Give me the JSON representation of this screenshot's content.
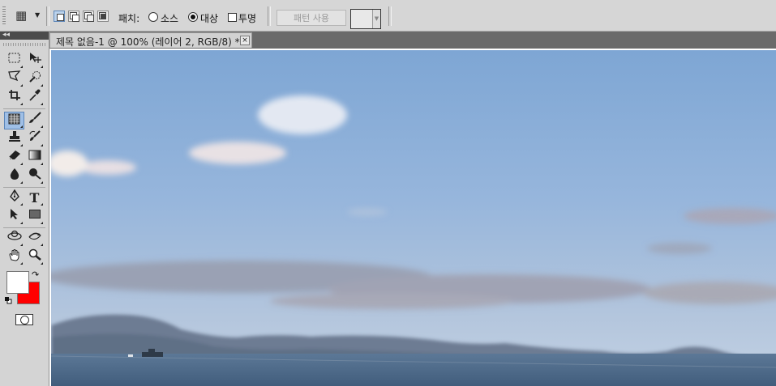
{
  "options_bar": {
    "tool_preset": {
      "icon": "patch-tool-icon"
    },
    "selection_modes": [
      "new-selection-icon",
      "add-to-selection-icon",
      "subtract-from-selection-icon",
      "intersect-selection-icon"
    ],
    "patch_label": "패치:",
    "source_label": "소스",
    "destination_label": "대상",
    "destination_selected": true,
    "transparent_label": "투명",
    "transparent_checked": false,
    "use_pattern_label": "패턴 사용"
  },
  "document": {
    "tab_title": "제목 없음-1 @ 100% (레이어 2, RGB/8) *",
    "close_label": "×"
  },
  "toolbox": {
    "tools": [
      "rectangular-marquee-icon",
      "move-tool-icon",
      "polygonal-lasso-icon",
      "quick-selection-icon",
      "crop-tool-icon",
      "eyedropper-icon",
      "patch-tool-icon",
      "brush-tool-icon",
      "clone-stamp-icon",
      "history-brush-icon",
      "eraser-icon",
      "gradient-tool-icon",
      "blur-tool-icon",
      "dodge-tool-icon",
      "pen-tool-icon",
      "type-tool-icon",
      "path-selection-icon",
      "rectangle-shape-icon",
      "3d-rotate-icon",
      "3d-orbit-icon",
      "hand-tool-icon",
      "zoom-tool-icon"
    ],
    "type_tool_glyph": "T",
    "selected_tool": "patch-tool-icon",
    "foreground_color": "#ffffff",
    "background_color": "#ff0000"
  },
  "colors": {
    "sky_top": "#7ea6d4",
    "sky_bottom": "#c3d2e4",
    "sea": "#4f6a8a",
    "mountains": "#6d7c93"
  }
}
